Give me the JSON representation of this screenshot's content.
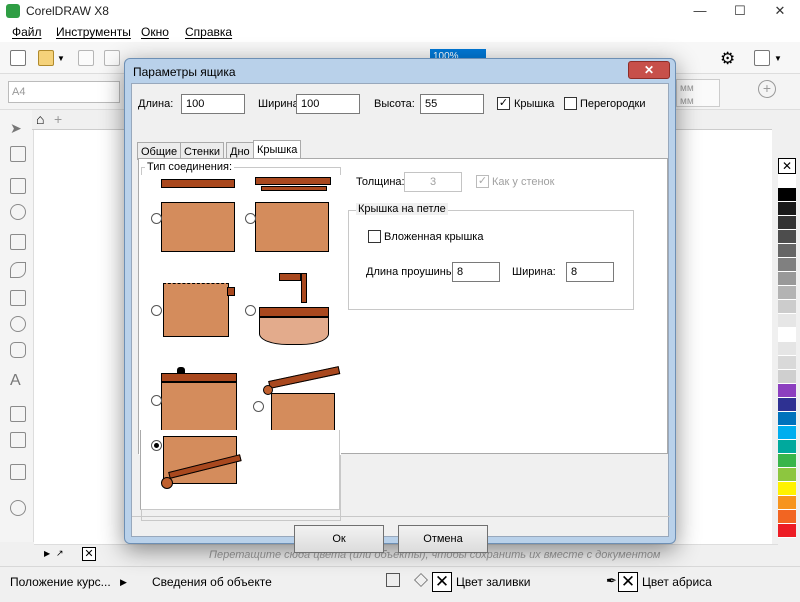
{
  "app": {
    "title": "CorelDRAW X8"
  },
  "menu": [
    "Файл",
    "Инструменты",
    "Окно",
    "Справка"
  ],
  "toolbar": {
    "zoom": "100%"
  },
  "propbar": {
    "paper": "A4",
    "units": [
      "мм",
      "мм"
    ]
  },
  "palette_hint": "Перетащите сюда цвета (или объекты), чтобы сохранить их вместе с документом",
  "status": {
    "cursor_pos": "Положение курс...",
    "object_info": "Сведения об объекте",
    "fill_label": "Цвет заливки",
    "outline_label": "Цвет абриса"
  },
  "dialog": {
    "title": "Параметры ящика",
    "length_label": "Длина:",
    "length_value": "100",
    "width_label": "Ширина:",
    "width_value": "100",
    "height_label": "Высота:",
    "height_value": "55",
    "lid_checkbox": "Крышка",
    "lid_checked": true,
    "partitions_checkbox": "Перегородки",
    "partitions_checked": false,
    "tabs": [
      "Общие",
      "Стенки",
      "Дно",
      "Крышка"
    ],
    "active_tab": "Крышка",
    "joint_group": "Тип соединения:",
    "selected_joint": 5,
    "thickness_label": "Толщина:",
    "thickness_value": "3",
    "same_as_walls": "Как у стенок",
    "hinge_group": "Крышка на петле",
    "inset_lid": "Вложенная крышка",
    "loop_length_label": "Длина проушины:",
    "loop_length_value": "8",
    "loop_width_label": "Ширина:",
    "loop_width_value": "8",
    "ok": "Ок",
    "cancel": "Отмена"
  },
  "colors": {
    "accent": "#0078d7",
    "box_fill": "#d48c5c",
    "lid_fill": "#a9481e",
    "dialog_frame": "#b9d1ea",
    "close_red": "#c7504a"
  },
  "palette_colors": [
    "#ffffff",
    "#000000",
    "#1a1a1a",
    "#333333",
    "#4d4d4d",
    "#666666",
    "#808080",
    "#999999",
    "#b3b3b3",
    "#cccccc",
    "#e6e6e6",
    "#ffffff",
    "#e5e5e5",
    "#d9d9d9",
    "#cfcfcf",
    "#8c3fbf",
    "#2e3192",
    "#0072bc",
    "#00aeef",
    "#00a99d",
    "#39b54a",
    "#8dc63f",
    "#fff200",
    "#f7941d",
    "#f26522",
    "#ed1c24",
    "#ec008c",
    "#92278f",
    "#c2b5d9",
    "#e0d3ec"
  ]
}
